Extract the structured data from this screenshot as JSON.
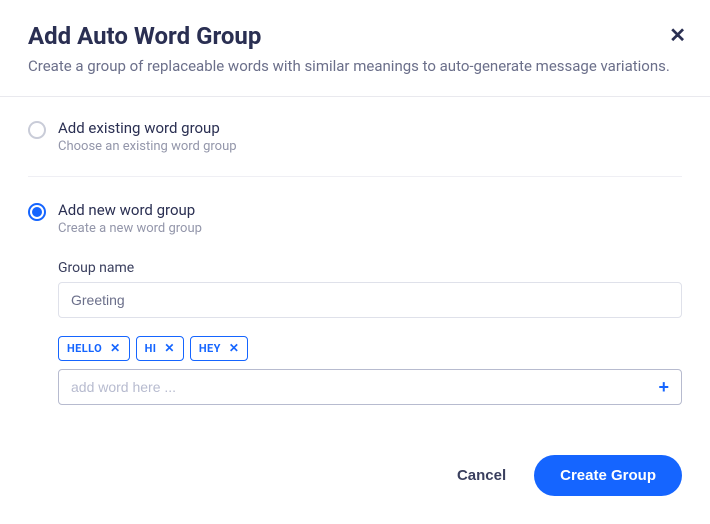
{
  "dialog": {
    "title": "Add Auto Word Group",
    "subtitle": "Create a group of replaceable words with similar meanings to auto-generate message variations."
  },
  "options": {
    "existing": {
      "title": "Add existing word group",
      "desc": "Choose an existing word group",
      "checked": false
    },
    "new": {
      "title": "Add new word group",
      "desc": "Create a new word group",
      "checked": true
    }
  },
  "form": {
    "group_name_label": "Group name",
    "group_name_value": "Greeting",
    "tags": [
      "HELLO",
      "HI",
      "HEY"
    ],
    "add_word_placeholder": "add word here ..."
  },
  "footer": {
    "cancel": "Cancel",
    "create": "Create Group"
  }
}
